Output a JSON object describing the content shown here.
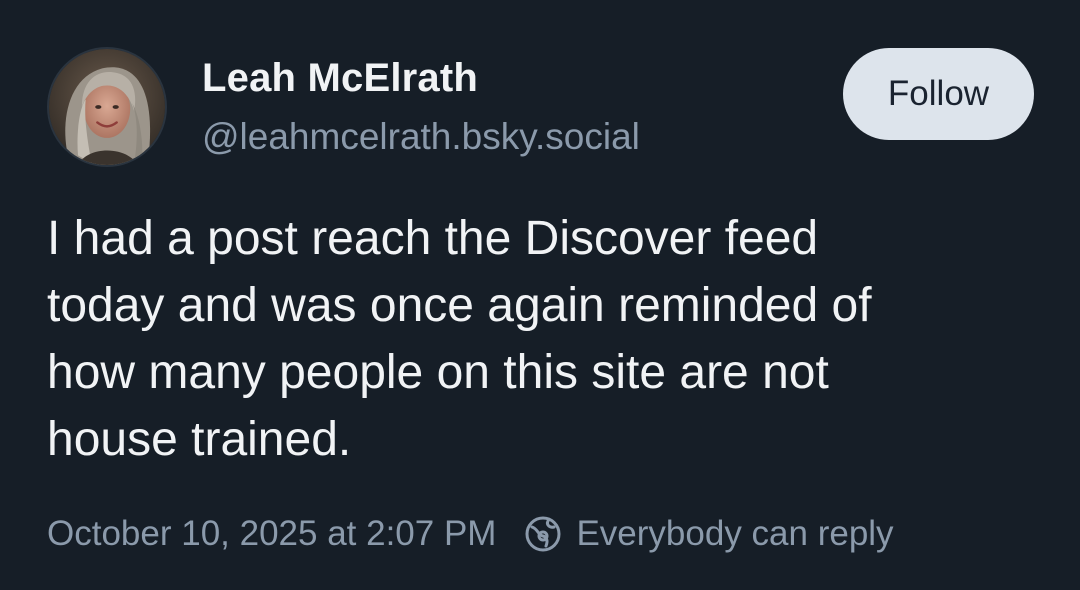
{
  "author": {
    "display_name": "Leah McElrath",
    "handle": "@leahmcelrath.bsky.social"
  },
  "follow_button": {
    "label": "Follow"
  },
  "post": {
    "text_lines": [
      "I had a post reach the Discover feed",
      "today and was once again reminded of",
      "how many people on this site are not",
      "house trained."
    ],
    "timestamp": "October 10, 2025 at 2:07 PM",
    "reply_setting": "Everybody can reply",
    "reply_icon": "globe-icon"
  },
  "colors": {
    "background": "#161e27",
    "text_primary": "#f1f3f5",
    "text_secondary": "#8b9aab",
    "button_bg": "#dde4ec",
    "button_text": "#1a2330"
  }
}
